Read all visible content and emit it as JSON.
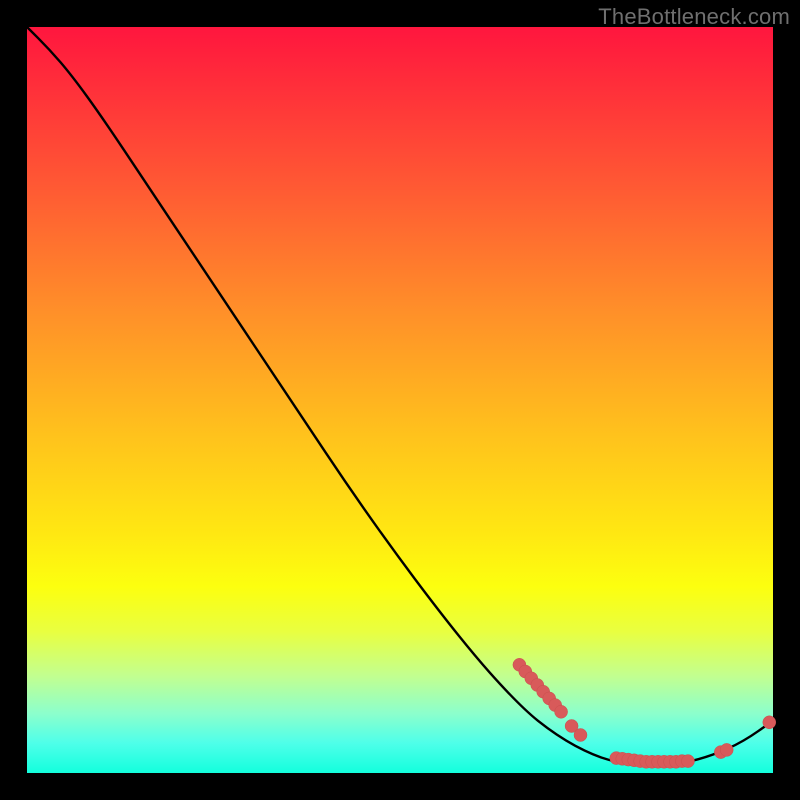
{
  "watermark": "TheBottleneck.com",
  "colors": {
    "background": "#000000",
    "curve_stroke": "#000000",
    "marker_fill": "#d85a5a",
    "marker_stroke": "#c94f4f",
    "gradient_top": "#ff163e",
    "gradient_mid": "#ffe812",
    "gradient_bottom": "#13ffdd"
  },
  "chart_data": {
    "type": "line",
    "title": "",
    "xlabel": "",
    "ylabel": "",
    "xlim": [
      0,
      100
    ],
    "ylim": [
      0,
      100
    ],
    "curve": [
      {
        "x": 0,
        "y": 100
      },
      {
        "x": 3,
        "y": 97
      },
      {
        "x": 6,
        "y": 93.5
      },
      {
        "x": 10,
        "y": 88
      },
      {
        "x": 16,
        "y": 79
      },
      {
        "x": 24,
        "y": 67
      },
      {
        "x": 34,
        "y": 52
      },
      {
        "x": 46,
        "y": 34
      },
      {
        "x": 58,
        "y": 18
      },
      {
        "x": 66,
        "y": 9
      },
      {
        "x": 71,
        "y": 5
      },
      {
        "x": 76,
        "y": 2.3
      },
      {
        "x": 80,
        "y": 1.2
      },
      {
        "x": 84,
        "y": 1.0
      },
      {
        "x": 88,
        "y": 1.3
      },
      {
        "x": 92,
        "y": 2.4
      },
      {
        "x": 96,
        "y": 4.2
      },
      {
        "x": 100,
        "y": 7.0
      }
    ],
    "markers": [
      {
        "x": 66.0,
        "y": 14.5
      },
      {
        "x": 66.8,
        "y": 13.6
      },
      {
        "x": 67.6,
        "y": 12.7
      },
      {
        "x": 68.4,
        "y": 11.8
      },
      {
        "x": 69.2,
        "y": 10.9
      },
      {
        "x": 70.0,
        "y": 10.0
      },
      {
        "x": 70.8,
        "y": 9.1
      },
      {
        "x": 71.6,
        "y": 8.2
      },
      {
        "x": 73.0,
        "y": 6.3
      },
      {
        "x": 74.2,
        "y": 5.1
      },
      {
        "x": 79.0,
        "y": 2.0
      },
      {
        "x": 79.8,
        "y": 1.9
      },
      {
        "x": 80.6,
        "y": 1.8
      },
      {
        "x": 81.4,
        "y": 1.7
      },
      {
        "x": 82.2,
        "y": 1.6
      },
      {
        "x": 83.0,
        "y": 1.5
      },
      {
        "x": 83.8,
        "y": 1.5
      },
      {
        "x": 84.6,
        "y": 1.5
      },
      {
        "x": 85.4,
        "y": 1.5
      },
      {
        "x": 86.2,
        "y": 1.5
      },
      {
        "x": 87.0,
        "y": 1.5
      },
      {
        "x": 87.8,
        "y": 1.6
      },
      {
        "x": 88.6,
        "y": 1.6
      },
      {
        "x": 93.0,
        "y": 2.8
      },
      {
        "x": 93.8,
        "y": 3.1
      },
      {
        "x": 99.5,
        "y": 6.8
      }
    ]
  }
}
